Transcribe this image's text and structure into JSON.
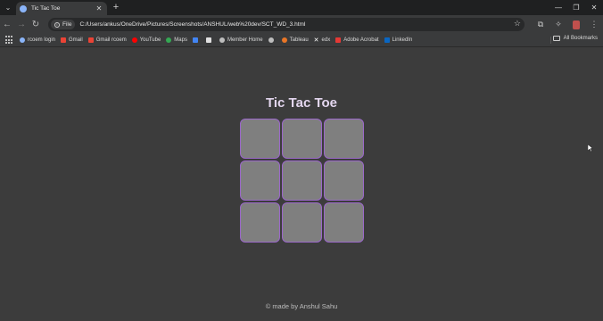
{
  "browser": {
    "tab": {
      "title": "Tic Tac Toe"
    },
    "address": {
      "scheme_label": "File",
      "url": "C:/Users/ankus/OneDrive/Pictures/Screenshots/ANSHUL/web%20dev/SCT_WD_3.html"
    },
    "bookmarks": [
      {
        "label": "rcoem login",
        "icon": "globe-icon",
        "color": "#8ab4f8"
      },
      {
        "label": "Gmail",
        "icon": "gmail-icon",
        "color": "#ea4335"
      },
      {
        "label": "Gmail rcoem",
        "icon": "gmail-icon",
        "color": "#ea4335"
      },
      {
        "label": "YouTube",
        "icon": "youtube-icon",
        "color": "#ff0000"
      },
      {
        "label": "Maps",
        "icon": "maps-icon",
        "color": "#34a853"
      },
      {
        "label": "",
        "icon": "docs-icon",
        "color": "#4285f4"
      },
      {
        "label": "",
        "icon": "chatgpt-icon",
        "color": "#e0e0e0"
      },
      {
        "label": "Member Home",
        "icon": "globe-icon",
        "color": "#bdbdbd"
      },
      {
        "label": "",
        "icon": "globe-icon",
        "color": "#bdbdbd"
      },
      {
        "label": "Tableau",
        "icon": "tableau-icon",
        "color": "#e97627"
      },
      {
        "label": "edx",
        "icon": "x-icon",
        "color": "#ffffff"
      },
      {
        "label": "Adobe Acrobat",
        "icon": "acrobat-icon",
        "color": "#e53935"
      },
      {
        "label": "LinkedIn",
        "icon": "linkedin-icon",
        "color": "#0a66c2"
      }
    ],
    "all_bookmarks_label": "All Bookmarks"
  },
  "page": {
    "title": "Tic Tac Toe",
    "board": [
      "",
      "",
      "",
      "",
      "",
      "",
      "",
      "",
      ""
    ],
    "footer": "© made by Anshul Sahu"
  }
}
